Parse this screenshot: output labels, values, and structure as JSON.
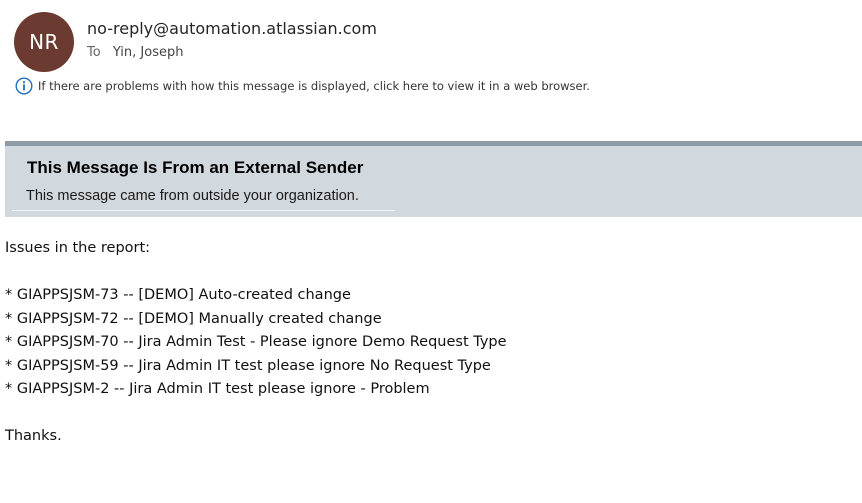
{
  "header": {
    "avatar_initials": "NR",
    "avatar_color": "#6b3b31",
    "sender": "no-reply@automation.atlassian.com",
    "to_label": "To",
    "to_name": "Yin, Joseph",
    "info_icon": "info-icon",
    "info_text": "If there are problems with how this message is displayed, click here to view it in a web browser."
  },
  "banner": {
    "title": "This Message Is From an External Sender",
    "subtitle": "This message came from outside your organization.",
    "background_color": "#d1d8de",
    "border_color": "#8e9ca8"
  },
  "body": {
    "intro": "Issues in the report:",
    "issues": [
      "* GIAPPSJSM-73 -- [DEMO] Auto-created change",
      "* GIAPPSJSM-72 -- [DEMO] Manually created change",
      "* GIAPPSJSM-70 -- Jira Admin Test - Please ignore Demo Request Type",
      "* GIAPPSJSM-59 -- Jira Admin IT test please ignore No Request Type",
      "* GIAPPSJSM-2 -- Jira Admin IT test please ignore - Problem"
    ],
    "closing": "Thanks."
  }
}
